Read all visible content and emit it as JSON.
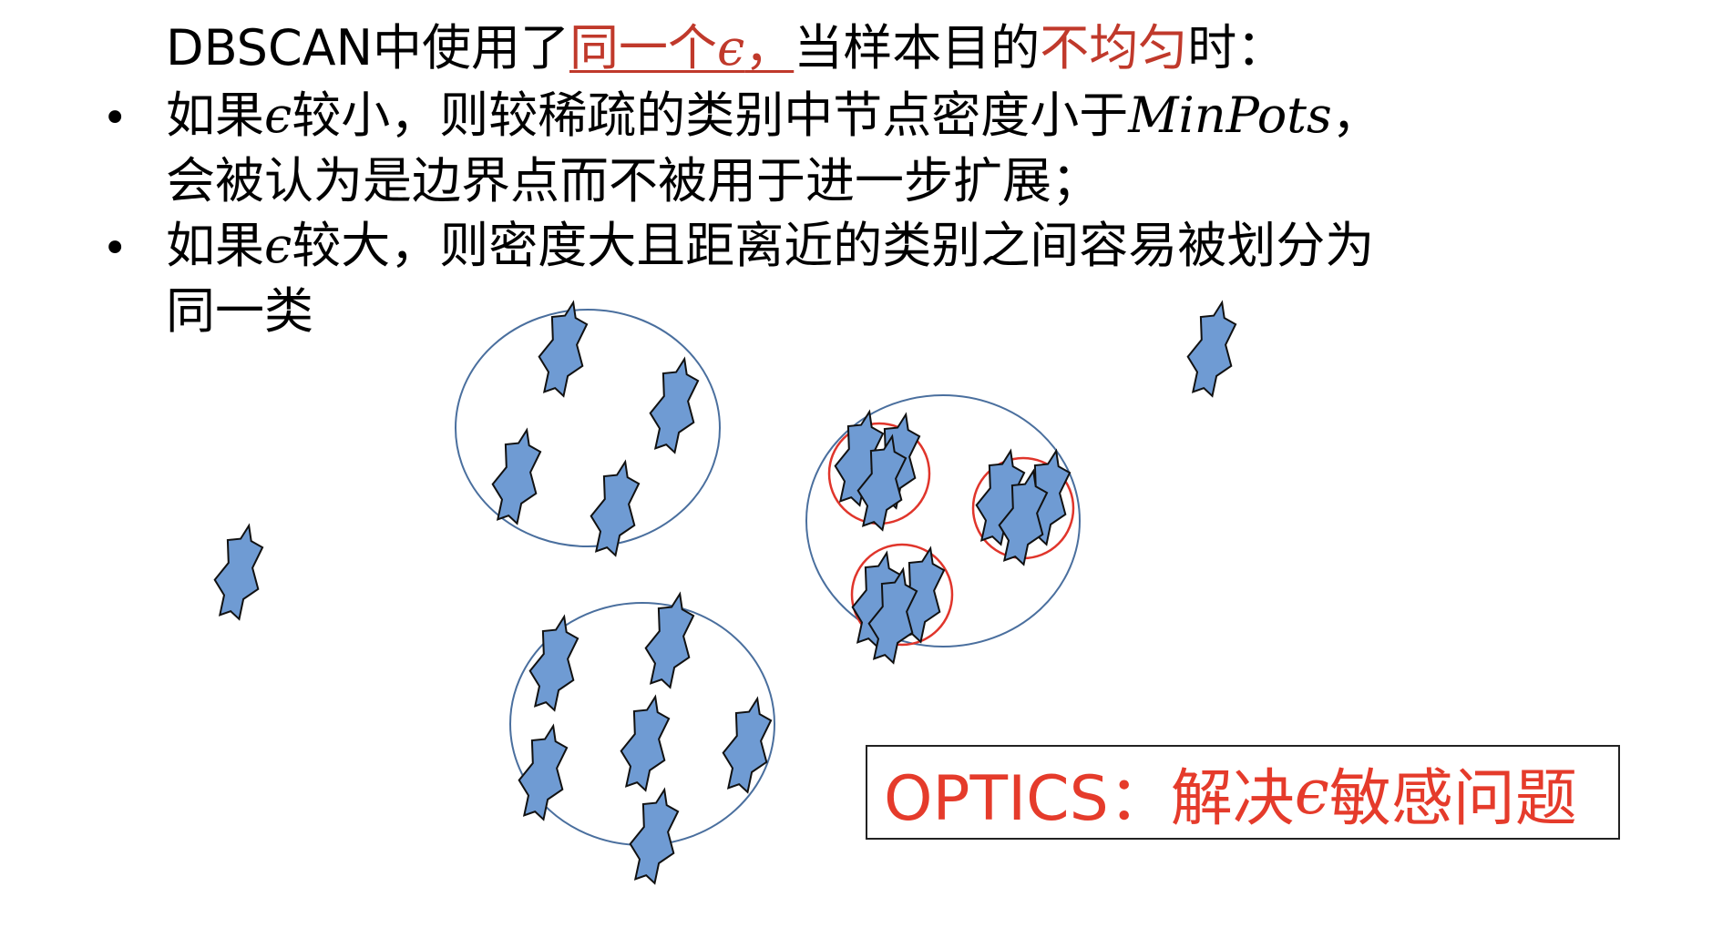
{
  "title_line": {
    "prefix": "DBSCAN中使用了",
    "highlight_same": "同一个",
    "epsilon": "ϵ",
    "comma_underlined": "，",
    "middle": "当样本目的",
    "highlight_uneven": "不均匀",
    "suffix": "时："
  },
  "bullets": [
    {
      "symbol": "•",
      "line1_prefix": "如果",
      "epsilon": "ϵ",
      "line1_mid": "较小，则较稀疏的类别中节点密度小于",
      "math": "MinPots",
      "line1_end": "，",
      "line2": "会被认为是边界点而不被用于进一步扩展；"
    },
    {
      "symbol": "•",
      "line1_prefix": "如果",
      "epsilon": "ϵ",
      "line1_mid": "较大，则密度大且距离近的类别之间容易被划分为",
      "line2": "同一类"
    }
  ],
  "callout": {
    "prefix": "OPTICS：解决",
    "epsilon": "ϵ",
    "suffix": "敏感问题"
  },
  "colors": {
    "highlight_text": "#c0392b",
    "callout_text": "#e53b2b",
    "point_fill": "#6f9bd3",
    "point_stroke": "#111111",
    "cluster_circle": "#4a6f9e",
    "sub_cluster_circle": "#e0352b"
  },
  "icons": {
    "data_point": "blue-star-point-icon"
  }
}
